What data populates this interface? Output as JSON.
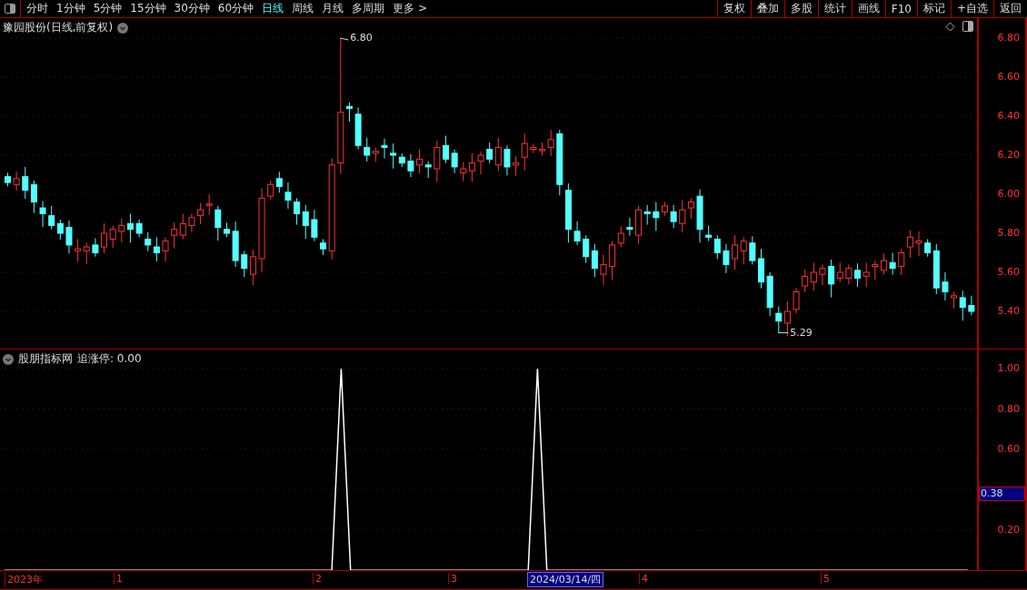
{
  "toolbar": {
    "tabs": [
      {
        "label": "分时",
        "selected": false
      },
      {
        "label": "1分钟",
        "selected": false
      },
      {
        "label": "5分钟",
        "selected": false
      },
      {
        "label": "15分钟",
        "selected": false
      },
      {
        "label": "30分钟",
        "selected": false
      },
      {
        "label": "60分钟",
        "selected": false
      },
      {
        "label": "日线",
        "selected": true
      },
      {
        "label": "周线",
        "selected": false
      },
      {
        "label": "月线",
        "selected": false
      },
      {
        "label": "多周期",
        "selected": false
      },
      {
        "label": "更多 >",
        "selected": false
      }
    ],
    "buttons": [
      "复权",
      "叠加",
      "多股",
      "统计",
      "画线",
      "F10",
      "标记",
      "+自选",
      "返回"
    ]
  },
  "price_chart": {
    "title": "豫园股份(日线,前复权)",
    "price_labels": [
      "6.80",
      "6.60",
      "6.40",
      "6.20",
      "6.00",
      "5.80",
      "5.60",
      "5.40"
    ],
    "high_label": "6.80",
    "low_label": "5.29"
  },
  "indicator": {
    "source": "股朋指标网",
    "readout_value": "0.00",
    "cursor_value": "0.38",
    "chart_data": {
      "type": "line",
      "grid": true,
      "ylim": [
        0,
        1.0
      ],
      "yticks": [
        {
          "value": 0.2,
          "label": "0.20"
        },
        {
          "value": 0.6,
          "label": "0.60"
        },
        {
          "value": 0.8,
          "label": "0.80"
        },
        {
          "value": 1.0,
          "label": "1.00"
        }
      ],
      "series": [
        {
          "name": "追涨停:",
          "color": "#ffffff",
          "values": [
            0,
            0,
            0,
            0,
            0,
            0,
            0,
            0,
            0,
            0,
            0,
            0,
            0,
            0,
            0,
            0,
            0,
            0,
            0,
            0,
            0,
            0,
            0,
            0,
            0,
            0,
            0,
            0,
            0,
            0,
            0,
            0,
            0,
            0,
            0,
            0,
            1,
            0,
            0,
            0,
            0,
            0,
            0,
            0,
            0,
            0,
            0,
            0,
            0,
            0,
            0,
            0,
            0,
            0,
            0,
            0,
            0,
            1,
            0,
            0,
            0,
            0,
            0,
            0,
            0,
            0,
            0,
            0,
            0,
            0,
            0,
            0,
            0,
            0,
            0,
            0,
            0,
            0,
            0,
            0,
            0,
            0,
            0,
            0,
            0,
            0,
            0,
            0,
            0,
            0,
            0,
            0,
            0,
            0,
            0,
            0,
            0,
            0,
            0,
            0,
            0,
            0,
            0,
            0
          ]
        }
      ]
    }
  },
  "date_axis": [
    {
      "label": "2023年",
      "selected": false
    },
    {
      "label": "1",
      "selected": false
    },
    {
      "label": "2",
      "selected": false
    },
    {
      "label": "3",
      "selected": false
    },
    {
      "label": "2024/03/14/四",
      "selected": true
    },
    {
      "label": "4",
      "selected": false
    },
    {
      "label": "5",
      "selected": false
    }
  ]
}
